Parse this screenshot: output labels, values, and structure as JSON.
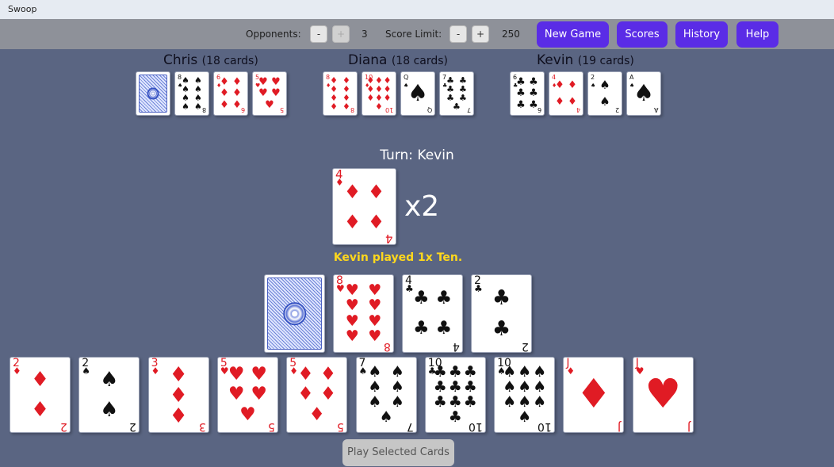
{
  "window": {
    "title": "Swoop"
  },
  "toolbar": {
    "opponents_label": "Opponents:",
    "opponents_minus": "-",
    "opponents_plus": "+",
    "opponents_value": "3",
    "score_limit_label": "Score Limit:",
    "score_minus": "-",
    "score_plus": "+",
    "score_value": "250",
    "new_game": "New Game",
    "scores": "Scores",
    "history": "History",
    "help": "Help",
    "accent_color": "#5a2ce6"
  },
  "players": [
    {
      "name": "Chris",
      "count": "(18 cards)",
      "cards": [
        {
          "rank": "",
          "suit": "",
          "back": true
        },
        {
          "rank": "8",
          "suit": "♠"
        },
        {
          "rank": "6",
          "suit": "♦"
        },
        {
          "rank": "5",
          "suit": "♥"
        }
      ]
    },
    {
      "name": "Diana",
      "count": "(18 cards)",
      "cards": [
        {
          "rank": "8",
          "suit": "♦"
        },
        {
          "rank": "10",
          "suit": "♦"
        },
        {
          "rank": "Q",
          "suit": "♠"
        },
        {
          "rank": "7",
          "suit": "♣"
        }
      ]
    },
    {
      "name": "Kevin",
      "count": "(19 cards)",
      "cards": [
        {
          "rank": "6",
          "suit": "♣"
        },
        {
          "rank": "4",
          "suit": "♦"
        },
        {
          "rank": "2",
          "suit": "♠"
        },
        {
          "rank": "A",
          "suit": "♠"
        }
      ]
    }
  ],
  "play_area": {
    "turn_text": "Turn: Kevin",
    "pile_card": {
      "rank": "4",
      "suit": "♦"
    },
    "multiplier": "x2",
    "message": "Kevin played 1x Ten.",
    "message_color": "#ffd81c"
  },
  "face_row": [
    {
      "rank": "",
      "suit": "",
      "back": true
    },
    {
      "rank": "8",
      "suit": "♥"
    },
    {
      "rank": "4",
      "suit": "♣"
    },
    {
      "rank": "2",
      "suit": "♣"
    }
  ],
  "hand": [
    {
      "rank": "2",
      "suit": "♦"
    },
    {
      "rank": "2",
      "suit": "♠"
    },
    {
      "rank": "3",
      "suit": "♦"
    },
    {
      "rank": "5",
      "suit": "♥"
    },
    {
      "rank": "5",
      "suit": "♦"
    },
    {
      "rank": "7",
      "suit": "♠"
    },
    {
      "rank": "10",
      "suit": "♣"
    },
    {
      "rank": "10",
      "suit": "♠"
    },
    {
      "rank": "J",
      "suit": "♦"
    },
    {
      "rank": "J",
      "suit": "♥"
    }
  ],
  "play_button": "Play Selected Cards"
}
